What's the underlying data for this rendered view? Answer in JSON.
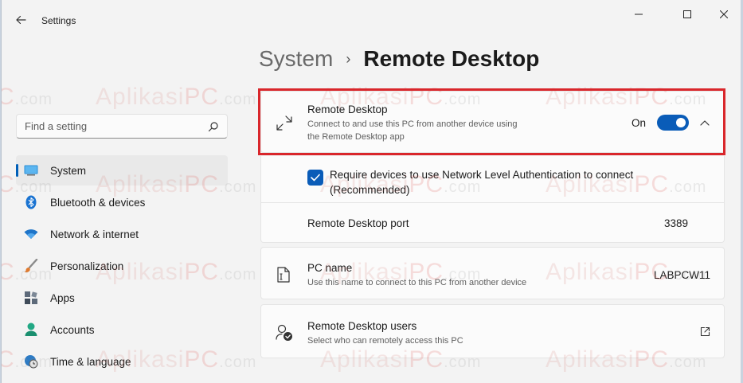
{
  "window": {
    "title": "Settings"
  },
  "header": {
    "breadcrumb_root": "System",
    "breadcrumb_separator": "›",
    "breadcrumb_current": "Remote Desktop"
  },
  "search": {
    "placeholder": "Find a setting"
  },
  "sidebar": {
    "items": [
      {
        "label": "System",
        "icon": "monitor-icon",
        "active": true
      },
      {
        "label": "Bluetooth & devices",
        "icon": "bluetooth-icon"
      },
      {
        "label": "Network & internet",
        "icon": "wifi-icon"
      },
      {
        "label": "Personalization",
        "icon": "brush-icon"
      },
      {
        "label": "Apps",
        "icon": "apps-icon"
      },
      {
        "label": "Accounts",
        "icon": "person-icon"
      },
      {
        "label": "Time & language",
        "icon": "globe-clock-icon"
      }
    ]
  },
  "remote_desktop": {
    "title": "Remote Desktop",
    "description_line1": "Connect to and use this PC from another device using",
    "description_line2": "the Remote Desktop app",
    "toggle_label": "On",
    "enabled": true
  },
  "nla": {
    "label_line1": "Require devices to use Network Level Authentication to connect",
    "label_line2": "(Recommended)",
    "checked": true
  },
  "port": {
    "label": "Remote Desktop port",
    "value": "3389"
  },
  "pc_name": {
    "title": "PC name",
    "description": "Use this name to connect to this PC from another device",
    "value": "LABPCW11"
  },
  "users": {
    "title": "Remote Desktop users",
    "description": "Select who can remotely access this PC"
  },
  "watermark": {
    "brand": "Aplikasi",
    "brand_accent": "PC",
    "suffix": ".com",
    "partial_accent": "C"
  },
  "colors": {
    "accent": "#005fb8",
    "highlight_border": "#d9262b",
    "background": "#f3f3f3",
    "card": "#fbfbfb"
  }
}
